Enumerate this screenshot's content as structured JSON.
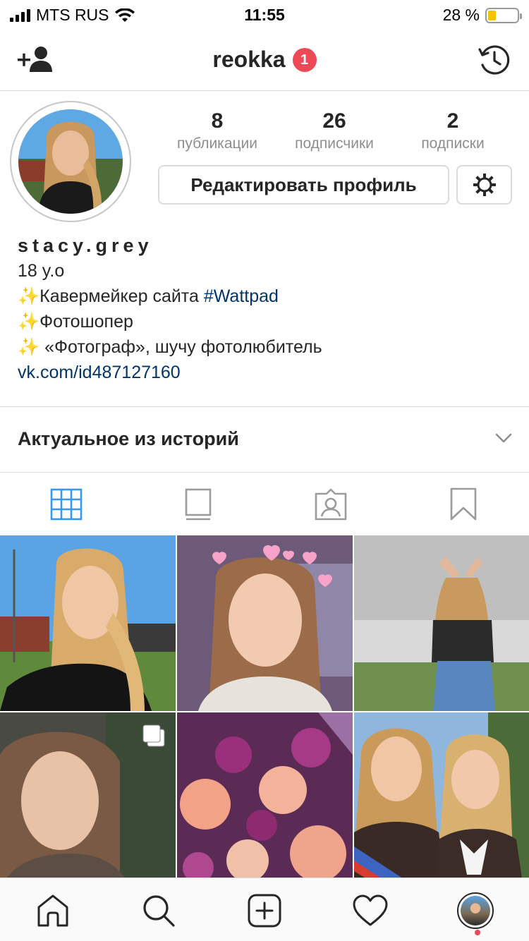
{
  "status_bar": {
    "carrier": "MTS RUS",
    "time": "11:55",
    "battery_text": "28 %",
    "battery_level": 0.28,
    "battery_color": "#f5c400"
  },
  "nav": {
    "add_person_icon": "add-person-icon",
    "username": "reokka",
    "notification_count": "1",
    "archive_icon": "archive-clock-icon"
  },
  "stats": [
    {
      "value": "8",
      "label": "публикации"
    },
    {
      "value": "26",
      "label": "подписчики"
    },
    {
      "value": "2",
      "label": "подписки"
    }
  ],
  "edit_profile_label": "Редактировать профиль",
  "bio": {
    "name": "stacy.grey",
    "line1": "18 y.o",
    "line2_emoji": "✨",
    "line2_text": "Кавермейкер сайта ",
    "line2_hashtag": "#Wattpad",
    "line3_emoji": "✨",
    "line3_text": "Фотошопер",
    "line4_emoji": "✨",
    "line4_text": " «Фотограф», шучу фотолюбитель",
    "link": "vk.com/id487127160"
  },
  "highlights_label": "Актуальное из историй",
  "tabs": [
    "grid-icon",
    "feed-icon",
    "tagged-icon",
    "saved-icon"
  ],
  "active_tab": 0,
  "accent_color": "#3897f0",
  "grid": [
    {
      "name": "photo-selfie-outdoor",
      "multi": false
    },
    {
      "name": "photo-selfie-hearts",
      "multi": false
    },
    {
      "name": "photo-back-heart-hands",
      "multi": false
    },
    {
      "name": "photo-portrait-dark",
      "multi": true
    },
    {
      "name": "photo-flowers-bouquet",
      "multi": false
    },
    {
      "name": "photo-graduation-friends",
      "multi": false
    }
  ],
  "tab_bar": [
    "home-icon",
    "search-icon",
    "new-post-icon",
    "activity-heart-icon",
    "profile-avatar"
  ]
}
